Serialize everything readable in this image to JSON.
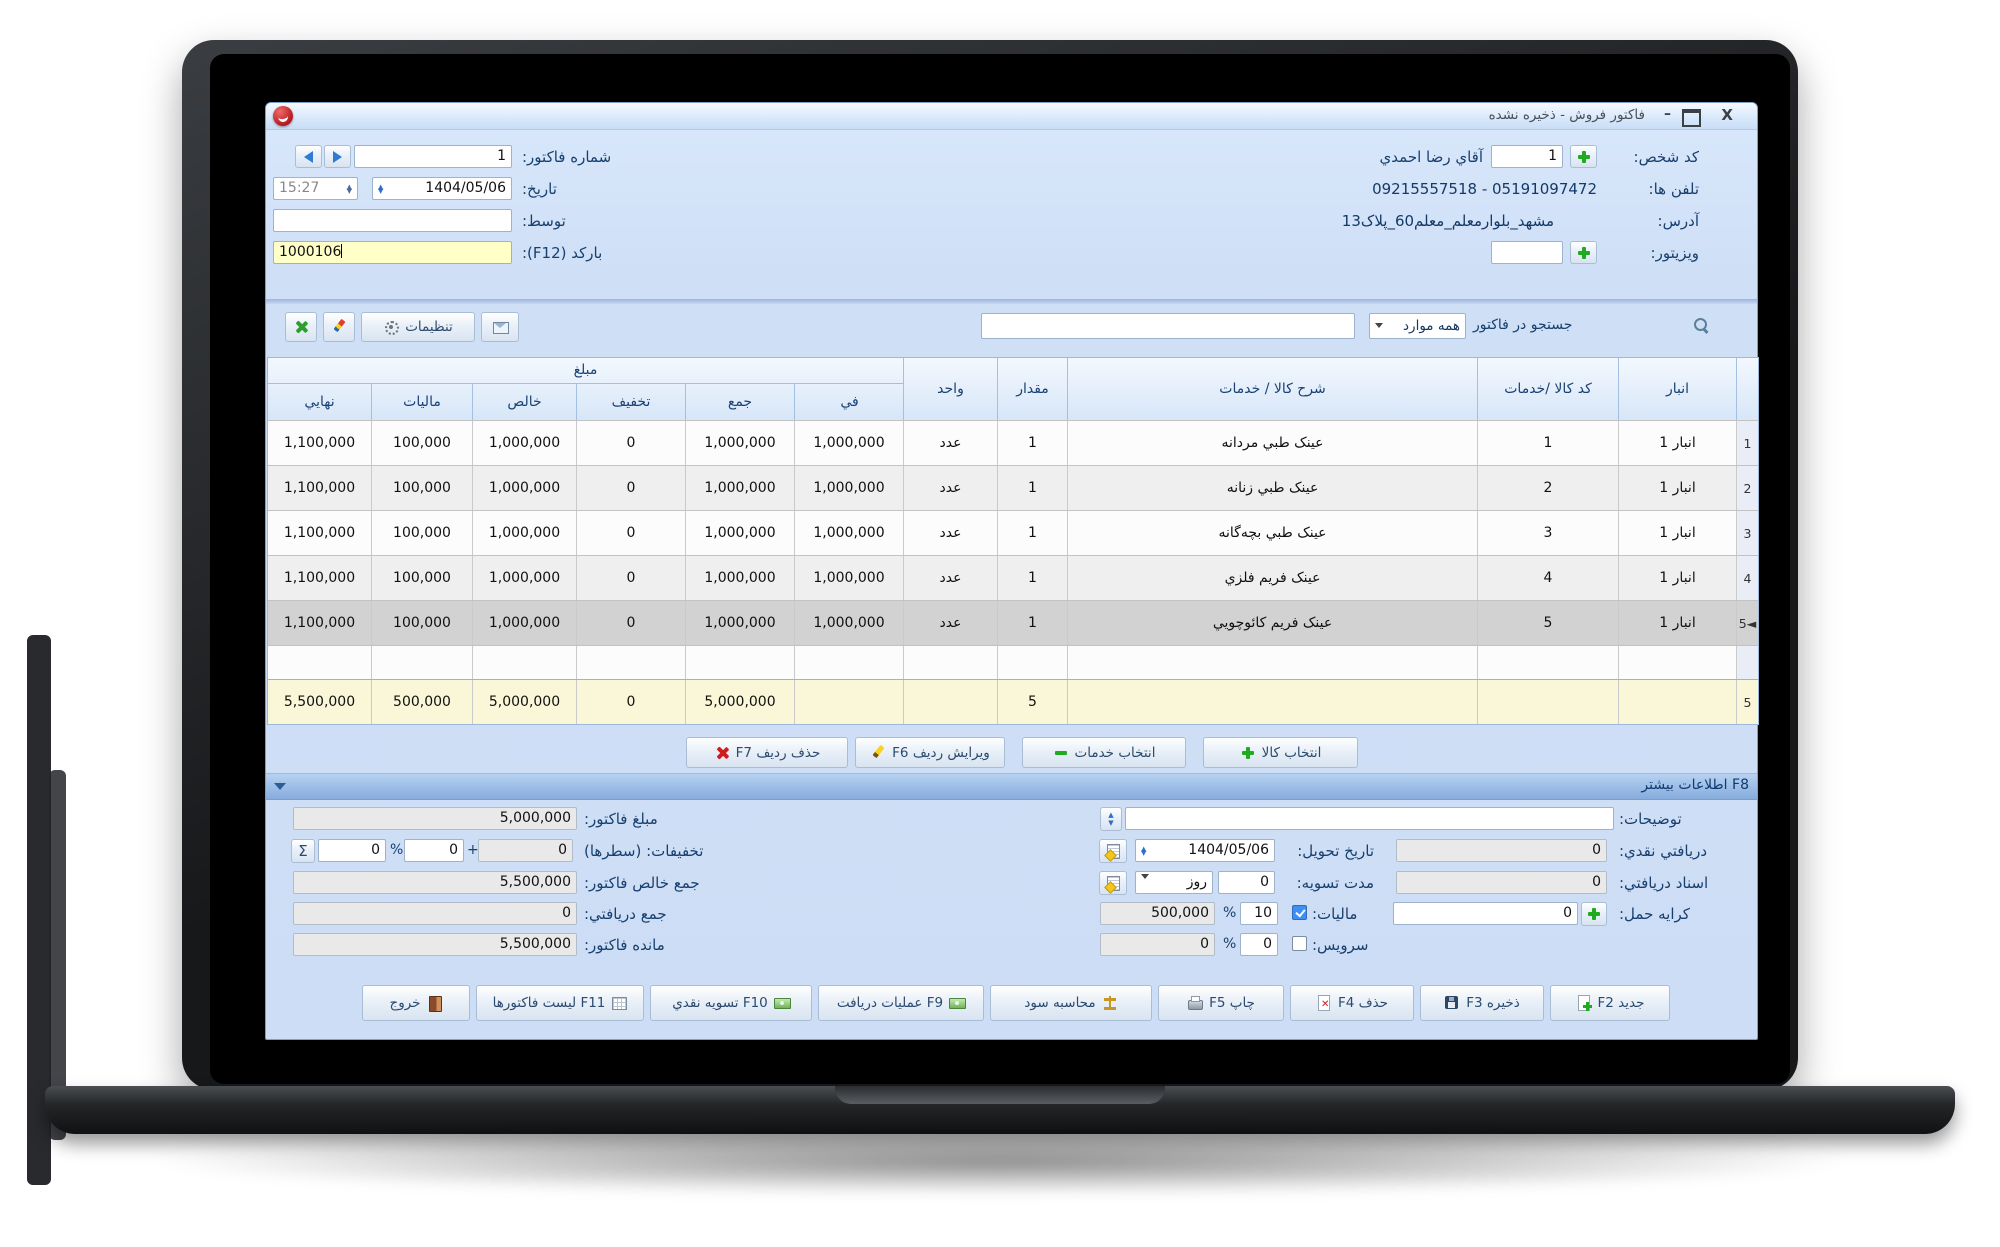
{
  "window": {
    "title": "فاکتور فروش - ذخیره نشده",
    "controls": {
      "minimize": "–",
      "close": "X"
    }
  },
  "header": {
    "right": {
      "person_code_label": "کد شخص:",
      "person_code_value": "1",
      "person_name": "آقاي رضا احمدي",
      "phones_label": "تلفن ها:",
      "phones_value": "05191097472 - 09215557518",
      "address_label": "آدرس:",
      "address_value": "مشهد_بلوارمعلم_معلم60_پلاک13",
      "visitor_label": "ویزیتور:",
      "visitor_value": ""
    },
    "left": {
      "invoice_no_label": "شماره فاکتور:",
      "invoice_no_value": "1",
      "date_label": "تاریخ:",
      "date_value": "1404/05/06",
      "time_value": "15:27",
      "by_label": "توسط:",
      "by_value": "",
      "barcode_label": "بارکد (F12):",
      "barcode_value": "1000106"
    }
  },
  "toolbar": {
    "settings_label": "تنظیمات",
    "search_label": "جستجو در فاکتور",
    "search_filter_value": "همه موارد",
    "search_input_value": ""
  },
  "table": {
    "group_header": "مبلغ",
    "columns": [
      "نهایي",
      "مالیات",
      "خالص",
      "تخفیف",
      "جمع",
      "في",
      "واحد",
      "مقدار",
      "شرح کالا / خدمات",
      "کد کالا /خدمات",
      "انبار",
      ""
    ],
    "rows": [
      {
        "selected": false,
        "cells": [
          "1,100,000",
          "100,000",
          "1,000,000",
          "0",
          "1,000,000",
          "1,000,000",
          "عدد",
          "1",
          "عینک طبي مردانه",
          "1",
          "انبار 1",
          "1"
        ]
      },
      {
        "selected": false,
        "cells": [
          "1,100,000",
          "100,000",
          "1,000,000",
          "0",
          "1,000,000",
          "1,000,000",
          "عدد",
          "1",
          "عینک طبي زنانه",
          "2",
          "انبار 1",
          "2"
        ]
      },
      {
        "selected": false,
        "cells": [
          "1,100,000",
          "100,000",
          "1,000,000",
          "0",
          "1,000,000",
          "1,000,000",
          "عدد",
          "1",
          "عینک طبي بچه‌گانه",
          "3",
          "انبار 1",
          "3"
        ]
      },
      {
        "selected": false,
        "cells": [
          "1,100,000",
          "100,000",
          "1,000,000",
          "0",
          "1,000,000",
          "1,000,000",
          "عدد",
          "1",
          "عینک فریم فلزي",
          "4",
          "انبار 1",
          "4"
        ]
      },
      {
        "selected": true,
        "cells": [
          "1,100,000",
          "100,000",
          "1,000,000",
          "0",
          "1,000,000",
          "1,000,000",
          "عدد",
          "1",
          "عینک فریم کائوچویي",
          "5",
          "انبار 1",
          "◄5"
        ]
      }
    ],
    "totals": [
      "5,500,000",
      "500,000",
      "5,000,000",
      "0",
      "5,000,000",
      "",
      "",
      "5",
      "",
      "",
      "",
      "5"
    ]
  },
  "row_actions": {
    "buttons": [
      {
        "label": "حذف ردیف F7",
        "icon": "redx",
        "side": "left"
      },
      {
        "label": "ویرایش ردیف F6",
        "icon": "pencil",
        "side": "left"
      },
      {
        "label": "انتخاب خدمات",
        "icon": "minus",
        "side": "left"
      },
      {
        "label": "انتخاب کالا",
        "icon": "plus",
        "side": "left"
      }
    ]
  },
  "more_info_bar": {
    "label": "F8 اطلاعات بیشتر"
  },
  "summary_left": {
    "invoice_amount_label": "مبلغ فاکتور:",
    "invoice_amount_value": "5,000,000",
    "discounts_label": "تخفیفات: (سطرها)",
    "discounts_rows_value": "0",
    "plus_sign": "+",
    "discount_amount_value": "0",
    "percent_sign": "%",
    "discount_percent_value": "0",
    "sigma_label": "Σ",
    "net_total_label": "جمع خالص فاکتور:",
    "net_total_value": "5,500,000",
    "received_total_label": "جمع دریافتي:",
    "received_total_value": "0",
    "balance_label": "مانده فاکتور:",
    "balance_value": "5,500,000"
  },
  "details_right": {
    "notes_label": "توضیحات:",
    "notes_value": "",
    "cash_received_label": "دریافتي نقدي:",
    "cash_received_value": "0",
    "delivery_date_label": "تاریخ تحویل:",
    "delivery_date_value": "1404/05/06",
    "received_docs_label": "اسناد دریافتي:",
    "received_docs_value": "0",
    "settlement_label": "مدت تسویه:",
    "settlement_value": "0",
    "settlement_unit_value": "روز",
    "freight_label": "کرایه حمل:",
    "freight_value": "0",
    "tax_label": "مالیات:",
    "tax_percent_value": "10",
    "tax_amount_value": "500,000",
    "service_label": "سرویس:",
    "service_percent_value": "0",
    "service_amount_value": "0",
    "percent_sign": "%"
  },
  "bottom_toolbar": {
    "buttons": [
      {
        "label": "خروج",
        "icon": "door",
        "side": "right"
      },
      {
        "label": "لیست فاکتورها F11",
        "icon": "grid",
        "side": "right"
      },
      {
        "label": "تسویه نقدي F10",
        "icon": "cash",
        "side": "right"
      },
      {
        "label": "عملیات دریافت F9",
        "icon": "cash",
        "side": "right"
      },
      {
        "label": "محاسبه سود",
        "icon": "scales",
        "side": "right"
      },
      {
        "label": "چاپ F5",
        "icon": "printer",
        "side": "left"
      },
      {
        "label": "حذف F4",
        "icon": "pagex",
        "side": "left"
      },
      {
        "label": "ذخیره F3",
        "icon": "floppy",
        "side": "left"
      },
      {
        "label": "جدید F2",
        "icon": "pageplus",
        "side": "left"
      }
    ]
  }
}
